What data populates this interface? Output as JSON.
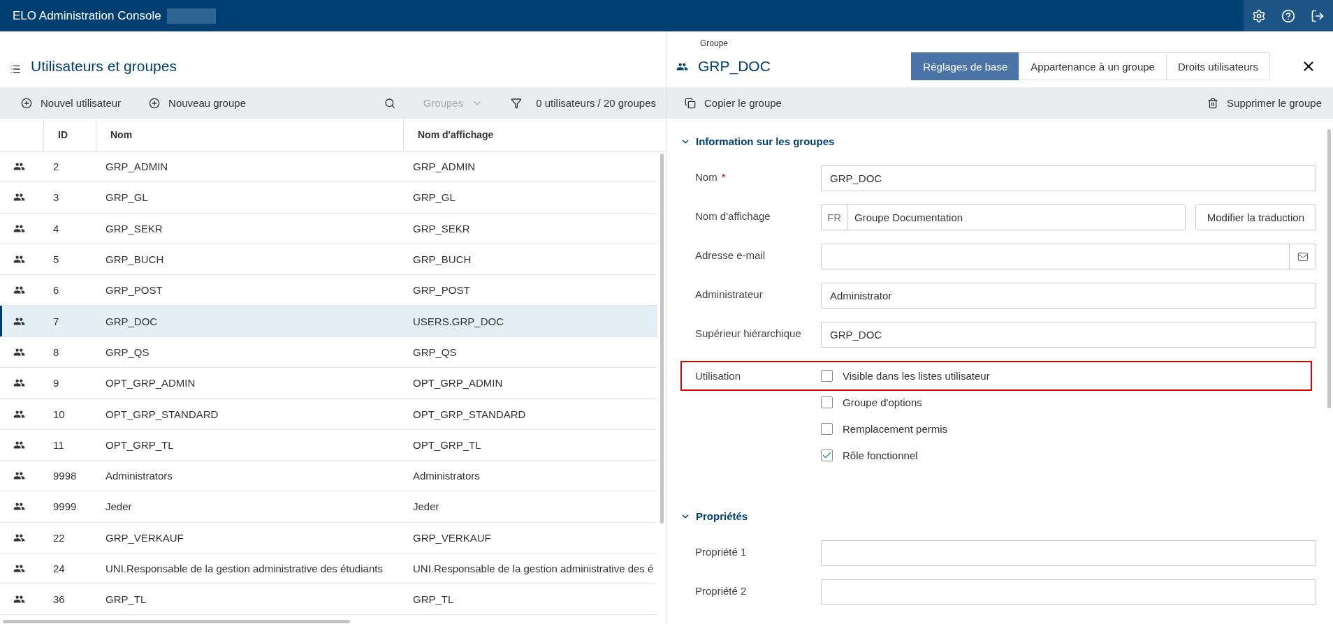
{
  "app_bar": {
    "title": "ELO Administration Console"
  },
  "list_panel": {
    "title": "Utilisateurs et groupes",
    "toolbar": {
      "new_user": "Nouvel utilisateur",
      "new_group": "Nouveau groupe",
      "type_dropdown": {
        "label": "Groupes",
        "disabled": true
      },
      "count": "0 utilisateurs / 20 groupes"
    },
    "table": {
      "columns": [
        "ID",
        "Nom",
        "Nom d'affichage"
      ],
      "rows": [
        {
          "id": "2",
          "name": "GRP_ADMIN",
          "display_name": "GRP_ADMIN",
          "selected": false
        },
        {
          "id": "3",
          "name": "GRP_GL",
          "display_name": "GRP_GL",
          "selected": false
        },
        {
          "id": "4",
          "name": "GRP_SEKR",
          "display_name": "GRP_SEKR",
          "selected": false
        },
        {
          "id": "5",
          "name": "GRP_BUCH",
          "display_name": "GRP_BUCH",
          "selected": false
        },
        {
          "id": "6",
          "name": "GRP_POST",
          "display_name": "GRP_POST",
          "selected": false
        },
        {
          "id": "7",
          "name": "GRP_DOC",
          "display_name": "USERS.GRP_DOC",
          "selected": true
        },
        {
          "id": "8",
          "name": "GRP_QS",
          "display_name": "GRP_QS",
          "selected": false
        },
        {
          "id": "9",
          "name": "OPT_GRP_ADMIN",
          "display_name": "OPT_GRP_ADMIN",
          "selected": false
        },
        {
          "id": "10",
          "name": "OPT_GRP_STANDARD",
          "display_name": "OPT_GRP_STANDARD",
          "selected": false
        },
        {
          "id": "11",
          "name": "OPT_GRP_TL",
          "display_name": "OPT_GRP_TL",
          "selected": false
        },
        {
          "id": "9998",
          "name": "Administrators",
          "display_name": "Administrators",
          "selected": false
        },
        {
          "id": "9999",
          "name": "Jeder",
          "display_name": "Jeder",
          "selected": false
        },
        {
          "id": "22",
          "name": "GRP_VERKAUF",
          "display_name": "GRP_VERKAUF",
          "selected": false
        },
        {
          "id": "24",
          "name": "UNI.Responsable de la gestion administrative des étudiants",
          "display_name": "UNI.Responsable de la gestion administrative des é",
          "selected": false
        },
        {
          "id": "36",
          "name": "GRP_TL",
          "display_name": "GRP_TL",
          "selected": false
        }
      ]
    }
  },
  "detail_panel": {
    "breadcrumb": "Groupe",
    "title": "GRP_DOC",
    "tabs": [
      {
        "label": "Réglages de base",
        "selected": true
      },
      {
        "label": "Appartenance à un groupe",
        "selected": false
      },
      {
        "label": "Droits utilisateurs",
        "selected": false
      }
    ],
    "toolbar": {
      "copy": "Copier le groupe",
      "delete": "Supprimer le groupe"
    },
    "sections": [
      {
        "title": "Information sur les groupes",
        "expanded": true,
        "fields": [
          {
            "kind": "text",
            "label": "Nom",
            "required_mark": "*",
            "value": "GRP_DOC"
          },
          {
            "kind": "translated",
            "label": "Nom d'affichage",
            "language": "FR",
            "value": "Groupe Documentation",
            "button": "Modifier la traduction"
          },
          {
            "kind": "email",
            "label": "Adresse e-mail"
          },
          {
            "kind": "text",
            "label": "Administrateur",
            "value": "Administrator"
          },
          {
            "kind": "text",
            "label": "Supérieur hiérarchique",
            "value": "GRP_DOC"
          },
          {
            "kind": "checkboxes",
            "label": "Utilisation",
            "options": [
              {
                "label": "Visible dans les listes utilisateur",
                "checked": false,
                "highlighted": true
              },
              {
                "label": "Groupe d'options",
                "checked": false,
                "highlighted": false
              },
              {
                "label": "Remplacement permis",
                "checked": false,
                "highlighted": false
              },
              {
                "label": "Rôle fonctionnel",
                "checked": true,
                "highlighted": false
              }
            ]
          }
        ]
      },
      {
        "title": "Propriétés",
        "expanded": true,
        "fields": [
          {
            "kind": "text",
            "label": "Propriété 1"
          },
          {
            "kind": "text",
            "label": "Propriété 2"
          }
        ]
      }
    ]
  }
}
